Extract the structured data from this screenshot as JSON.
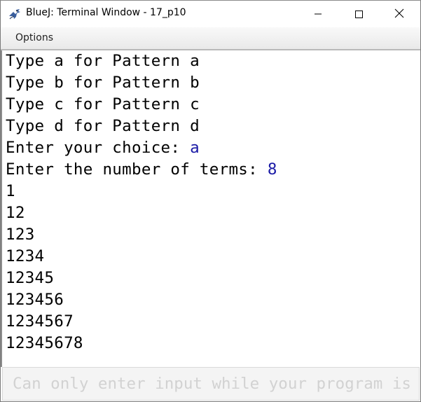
{
  "window": {
    "title": "BlueJ: Terminal Window - 17_p10",
    "app_icon": "bluej-bird-icon",
    "controls": [
      "minimize-icon",
      "maximize-icon",
      "close-icon"
    ]
  },
  "menubar": {
    "items": [
      {
        "label": "Options"
      }
    ]
  },
  "terminal": {
    "lines": [
      {
        "text": "Type a for Pattern a",
        "input": ""
      },
      {
        "text": "Type b for Pattern b",
        "input": ""
      },
      {
        "text": "Type c for Pattern c",
        "input": ""
      },
      {
        "text": "Type d for Pattern d",
        "input": ""
      },
      {
        "text": "Enter your choice: ",
        "input": "a"
      },
      {
        "text": "Enter the number of terms: ",
        "input": "8"
      },
      {
        "text": "1",
        "input": ""
      },
      {
        "text": "12",
        "input": ""
      },
      {
        "text": "123",
        "input": ""
      },
      {
        "text": "1234",
        "input": ""
      },
      {
        "text": "12345",
        "input": ""
      },
      {
        "text": "123456",
        "input": ""
      },
      {
        "text": "1234567",
        "input": ""
      },
      {
        "text": "12345678",
        "input": ""
      }
    ],
    "input_color": "#1a1aa6"
  },
  "input_bar": {
    "placeholder": "Can only enter input while your program is running"
  }
}
